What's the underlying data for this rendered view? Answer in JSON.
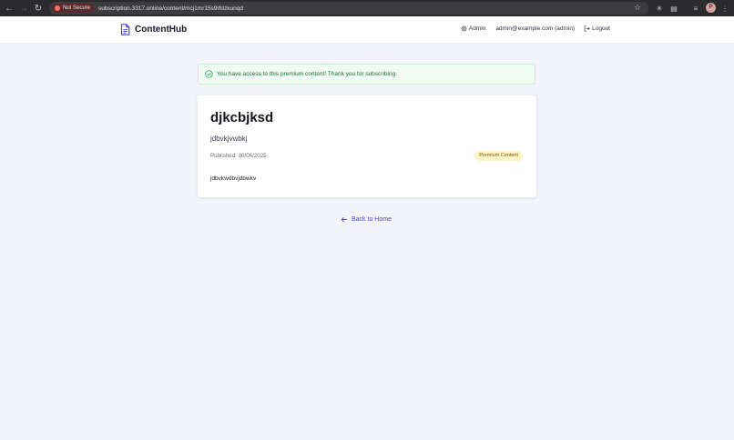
{
  "browser": {
    "security_chip": "Not Secure",
    "url": "subscription.3317.online/content/mcj1mr15s9rfdzkunqd",
    "profile_initial": "P"
  },
  "header": {
    "brand": "ContentHub",
    "admin_link": "Admin",
    "user_email": "admin@example.com (admin)",
    "logout_link": "Logout"
  },
  "alert": {
    "message": "You have access to this premium content! Thank you for subscribing."
  },
  "content": {
    "title": "djkcbjksd",
    "subtitle": "jdbvkjvwbkj",
    "published": "Published: 30/06/2025",
    "badge": "Premium Content",
    "body": "jdbvkwdbvjdbwkv"
  },
  "footer": {
    "back_link": "Back to Home"
  },
  "colors": {
    "accent": "#4f46c8",
    "success_bg": "#f0fbf3",
    "success_text": "#1e6b3a",
    "badge_bg": "#fdf3c6",
    "badge_text": "#7a5a06",
    "page_bg": "#f3f3fa"
  }
}
